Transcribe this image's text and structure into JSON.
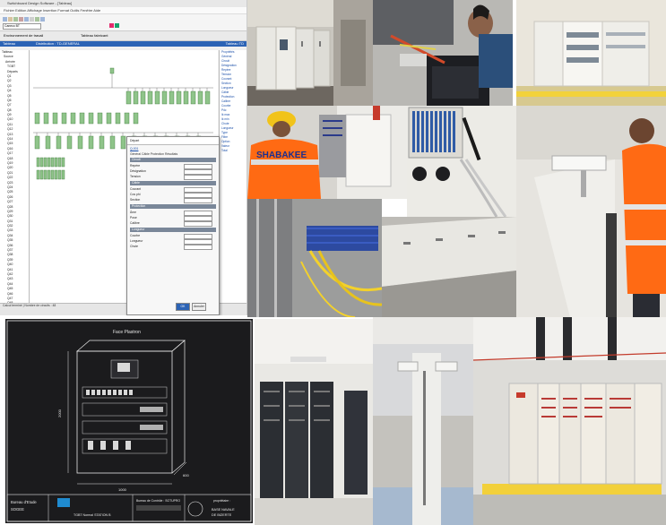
{
  "collage": {
    "tiles": [
      {
        "name": "software-screenshot"
      },
      {
        "name": "electrical-cabinet-room"
      },
      {
        "name": "technician-wiring-laptop"
      },
      {
        "name": "switchboard-cabinet"
      },
      {
        "name": "worker-orange-vest-cabinet"
      },
      {
        "name": "fiber-patch-panel"
      },
      {
        "name": "worker-cable-tray"
      },
      {
        "name": "cable-tray-fiber"
      },
      {
        "name": "cabinet-underside"
      },
      {
        "name": "cad-drawing"
      },
      {
        "name": "server-racks"
      },
      {
        "name": "column-cameras"
      },
      {
        "name": "distribution-board-lineup"
      }
    ]
  },
  "software": {
    "title": "Switchboard Design Software - [Tableau]",
    "menu": "Fichier  Edition  Affichage  Insertion  Format  Outils  Fenêtre  Aide",
    "toolbar_field": "Caneco BT",
    "bar2_left": "Environnement de travail",
    "bar2_mid": "Tableau fabricant",
    "bluebar_left": "Tableau",
    "bluebar_mid": "Distribution : TD-GENERAL",
    "bluebar_right": "Tableau TD",
    "tree": [
      "Tableau",
      "Source",
      "Arrivée",
      "TGBT",
      "Départs",
      "Q1",
      "Q2",
      "Q3",
      "Q4",
      "Q5",
      "Q6",
      "Q7",
      "Q8",
      "Q9",
      "Q10",
      "Q11",
      "Q12",
      "Q13",
      "Q14",
      "Q15",
      "Q16",
      "Q17",
      "Q18",
      "Q19",
      "Q20",
      "Q21",
      "Q22",
      "Q23",
      "Q24",
      "Q25",
      "Q26",
      "Q27",
      "Q28",
      "Q29",
      "Q30",
      "Q31",
      "Q32",
      "Q33",
      "Q34",
      "Q35",
      "Q36",
      "Q37",
      "Q38",
      "Q39",
      "Q40",
      "Q41",
      "Q42",
      "Q43",
      "Q44",
      "Q45",
      "Q46",
      "Q47",
      "Q48",
      "Q49",
      "Q50"
    ],
    "right_panel": [
      "Propriétés",
      "Général",
      "Circuit",
      "Désignation",
      "Repère",
      "Tension",
      "Courant",
      "Section",
      "Longueur",
      "Câble",
      "Protection",
      "Calibre",
      "Courbe",
      "Pdc",
      "Ik max",
      "Ik min",
      "Chute",
      "Longueur",
      "Type",
      "Filtre",
      "Option",
      "Valeur",
      "Total"
    ],
    "status": "Calcul terminé  |  Nombre de circuits : 48",
    "dialog": {
      "title": "Départ",
      "link": "Q-001",
      "tabs": "Général  Câble  Protection  Résultats",
      "sec1": "Circuit",
      "sec2": "Câble",
      "sec3": "Protection",
      "sec4": "Longueur",
      "rows": [
        "Repère",
        "Désignation",
        "Tension",
        "Courant",
        "Cos phi",
        "Section",
        "Âme",
        "Pose",
        "Calibre",
        "Courbe",
        "Longueur",
        "Chute"
      ],
      "ok": "OK",
      "cancel": "Annuler"
    }
  },
  "vest_text": "SHABAKEE",
  "cad": {
    "header": "Face Plastron",
    "dim_h": "2000",
    "dim_w": "1000",
    "dim_d": "600",
    "footer_left": "Bureau d'Etude",
    "footer_code": "SOGEE",
    "footer_mid": "TGBT Normal STATION B",
    "footer_title": "Bureau de Contrôle : SOTUPRO",
    "footer_right_1": "BASE NAVALE",
    "footer_right_2": "DE BIZERTE",
    "footer_owner": "propriétaire :"
  }
}
